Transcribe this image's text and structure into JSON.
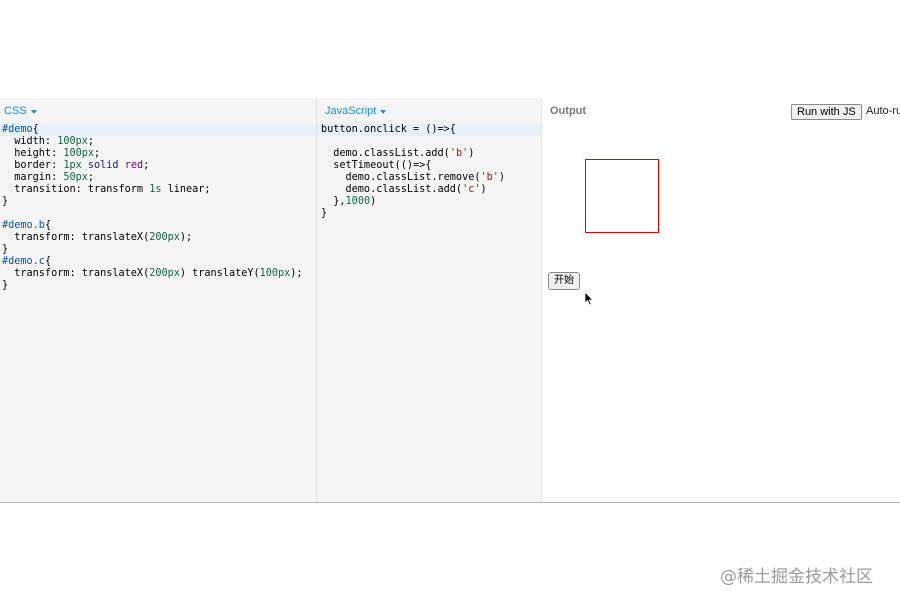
{
  "css_panel": {
    "language": "CSS",
    "lines": [
      [
        {
          "t": "#demo",
          "c": "sel"
        },
        {
          "t": "{"
        }
      ],
      [
        {
          "t": "  width: "
        },
        {
          "t": "100px",
          "c": "num"
        },
        {
          "t": ";"
        }
      ],
      [
        {
          "t": "  height: "
        },
        {
          "t": "100px",
          "c": "num"
        },
        {
          "t": ";"
        }
      ],
      [
        {
          "t": "  border: "
        },
        {
          "t": "1px",
          "c": "num"
        },
        {
          "t": " solid ",
          "c": "kw"
        },
        {
          "t": "red",
          "c": "atom"
        },
        {
          "t": ";"
        }
      ],
      [
        {
          "t": "  margin: "
        },
        {
          "t": "50px",
          "c": "num"
        },
        {
          "t": ";"
        }
      ],
      [
        {
          "t": "  transition: transform "
        },
        {
          "t": "1s",
          "c": "num"
        },
        {
          "t": " linear;"
        }
      ],
      [
        {
          "t": "}"
        }
      ],
      [
        {
          "t": ""
        }
      ],
      [
        {
          "t": "#demo",
          "c": "sel"
        },
        {
          "t": ".b",
          "c": "sel"
        },
        {
          "t": "{"
        }
      ],
      [
        {
          "t": "  transform: translateX("
        },
        {
          "t": "200px",
          "c": "num"
        },
        {
          "t": ");"
        }
      ],
      [
        {
          "t": "}"
        }
      ],
      [
        {
          "t": "#demo",
          "c": "sel"
        },
        {
          "t": ".c",
          "c": "sel"
        },
        {
          "t": "{"
        }
      ],
      [
        {
          "t": "  transform: translateX("
        },
        {
          "t": "200px",
          "c": "num"
        },
        {
          "t": ") translateY("
        },
        {
          "t": "100px",
          "c": "num"
        },
        {
          "t": ");"
        }
      ],
      [
        {
          "t": "}"
        }
      ]
    ]
  },
  "js_panel": {
    "language": "JavaScript",
    "lines": [
      [
        {
          "t": "button.onclick = ()=>{"
        }
      ],
      [
        {
          "t": ""
        }
      ],
      [
        {
          "t": "  demo.classList.add("
        },
        {
          "t": "'b'",
          "c": "str"
        },
        {
          "t": ")"
        }
      ],
      [
        {
          "t": "  setTimeout(()=>{"
        }
      ],
      [
        {
          "t": "    demo.classList.remove("
        },
        {
          "t": "'b'",
          "c": "str"
        },
        {
          "t": ")"
        }
      ],
      [
        {
          "t": "    demo.classList.add("
        },
        {
          "t": "'c'",
          "c": "str"
        },
        {
          "t": ")"
        }
      ],
      [
        {
          "t": "  },"
        },
        {
          "t": "1000",
          "c": "num"
        },
        {
          "t": ")"
        }
      ],
      [
        {
          "t": "}"
        }
      ]
    ]
  },
  "output_panel": {
    "title": "Output",
    "run_button": "Run with JS",
    "autorun_label": "Auto-run JS",
    "start_button": "开始"
  },
  "watermark": "@稀土掘金技术社区",
  "colors": {
    "accent": "#1a8fd8",
    "demo_border": "#dd0000"
  }
}
